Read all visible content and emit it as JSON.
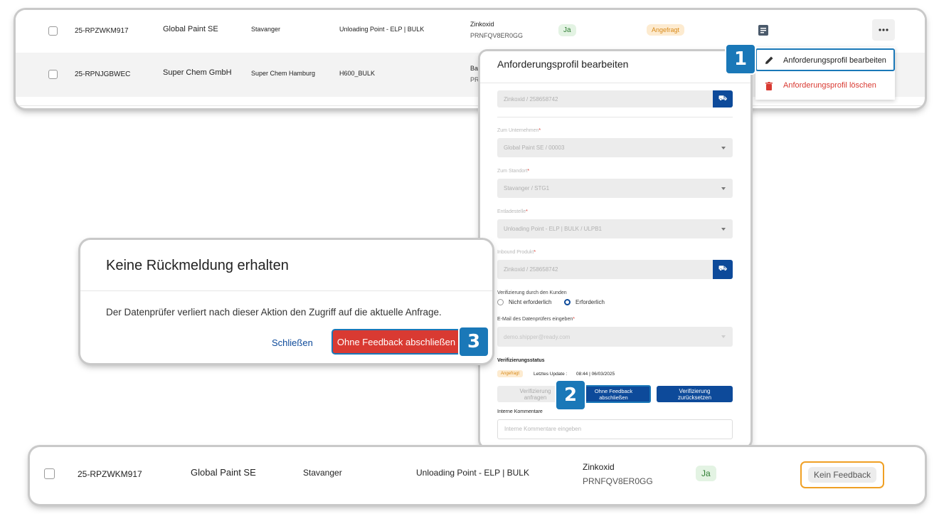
{
  "top_table": {
    "rows": [
      {
        "id": "25-RPZWKM917",
        "company": "Global Paint SE",
        "location": "Stavanger",
        "unloading": "Unloading Point - ELP | BULK",
        "product": "Zinkoxid",
        "product_code": "PRNFQV8ER0GG",
        "verification": "Ja",
        "status": "Angefragt"
      },
      {
        "id": "25-RPNJGBWEC",
        "company": "Super Chem GmbH",
        "location": "Super Chem Hamburg",
        "unloading": "H600_BULK",
        "product": "Bas",
        "product_code": "PR"
      }
    ]
  },
  "context_menu": {
    "edit_label": "Anforderungsprofil bearbeiten",
    "delete_label": "Anforderungsprofil löschen"
  },
  "edit_panel": {
    "title": "Anforderungsprofil bearbeiten",
    "product_top_value": "Zinkoxid / 258658742",
    "company_label": "Zum Unternehmen",
    "company_value": "Global Paint SE / 00003",
    "site_label": "Zum Standort",
    "site_value": "Stavanger / STG1",
    "unloading_label": "Entladestelle",
    "unloading_value": "Unloading Point - ELP | BULK / ULPB1",
    "inbound_label": "Inbound Produkt",
    "inbound_value": "Zinkoxid / 258658742",
    "required_mark": "*",
    "customer_verification_label": "Verifizierung durch den Kunden",
    "option_not_required": "Nicht erforderlich",
    "option_required": "Erforderlich",
    "email_label": "E-Mail des Datenprüfers eingeben",
    "email_value": "demo.shipper@ready.com",
    "verification_status_label": "Verifizierungsstatus",
    "status_badge": "Angefragt",
    "last_update_label": "Letztes Update :",
    "last_update_value": "08:44 | 06/03/2025",
    "btn_request_line1": "Verifizierung",
    "btn_request_line2": "anfragen",
    "btn_no_feedback_line1": "Ohne Feedback",
    "btn_no_feedback_line2": "abschließen",
    "btn_reset_line1": "Verifizierung",
    "btn_reset_line2": "zurücksetzen",
    "comments_label": "Interne Kommentare",
    "comments_placeholder": "Interne Kommentare eingeben"
  },
  "dialog": {
    "title": "Keine Rückmeldung erhalten",
    "body": "Der Datenprüfer verliert nach dieser Aktion den Zugriff auf die aktuelle Anfrage.",
    "close_label": "Schließen",
    "confirm_label": "Ohne Feedback abschließen"
  },
  "bottom_row": {
    "id": "25-RPZWKM917",
    "company": "Global Paint SE",
    "location": "Stavanger",
    "unloading": "Unloading Point - ELP | BULK",
    "product": "Zinkoxid",
    "product_code": "PRNFQV8ER0GG",
    "verification": "Ja",
    "status": "Kein Feedback"
  },
  "step_badges": [
    "1",
    "2",
    "3"
  ],
  "colors": {
    "primary": "#0d4a9a",
    "step_badge": "#1a78b8",
    "danger": "#d93a32",
    "highlight_orange": "#f0a024",
    "yes_green_bg": "#e3f3e3",
    "requested_bg": "#fdebd0"
  },
  "icons": {
    "row_note": "note-icon",
    "row_menu": "more-horizontal-icon",
    "edit": "pencil-icon",
    "delete": "trash-icon",
    "truck": "truck-icon"
  }
}
